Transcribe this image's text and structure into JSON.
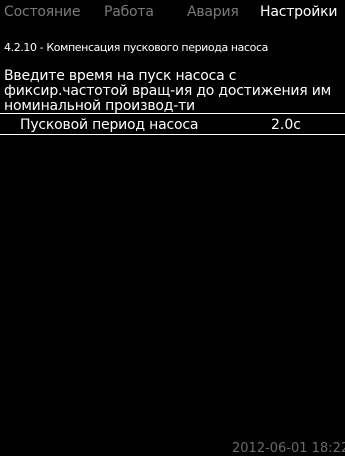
{
  "tabs": [
    {
      "label": "Состояние",
      "active": false
    },
    {
      "label": "Работа",
      "active": false
    },
    {
      "label": "Авария",
      "active": false
    },
    {
      "label": "Настройки",
      "active": true
    }
  ],
  "breadcrumb": "4.2.10 - Компенсация пускового периода насоса",
  "description": [
    "Введите время на пуск насоса с",
    "фиксир.частотой вращ-ия до достижения им",
    "номинальной производ-ти"
  ],
  "setting": {
    "label": "Пусковой период насоса",
    "value": "2.0с"
  },
  "timestamp": "2012-06-01 18:22",
  "colors": {
    "background": "#000000",
    "text": "#ffffff",
    "inactive_tab": "#7a7a7a"
  }
}
